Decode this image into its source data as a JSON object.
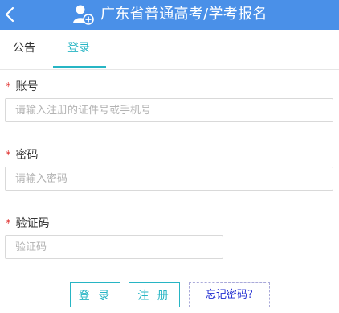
{
  "header": {
    "title": "广东省普通高考/学考报名",
    "back_icon": "chevron-left-icon",
    "app_icon": "user-add-icon",
    "color": "#4a90e8"
  },
  "tabs": [
    {
      "label": "公告",
      "active": false
    },
    {
      "label": "登录",
      "active": true
    }
  ],
  "accent_color": "#27b5c4",
  "form": {
    "required_mark": "*",
    "account": {
      "label": "账号",
      "placeholder": "请输入注册的证件号或手机号"
    },
    "password": {
      "label": "密码",
      "placeholder": "请输入密码"
    },
    "captcha": {
      "label": "验证码",
      "placeholder": "验证码"
    }
  },
  "buttons": {
    "login": "登 录",
    "register": "注 册",
    "forgot": "忘记密码?"
  }
}
